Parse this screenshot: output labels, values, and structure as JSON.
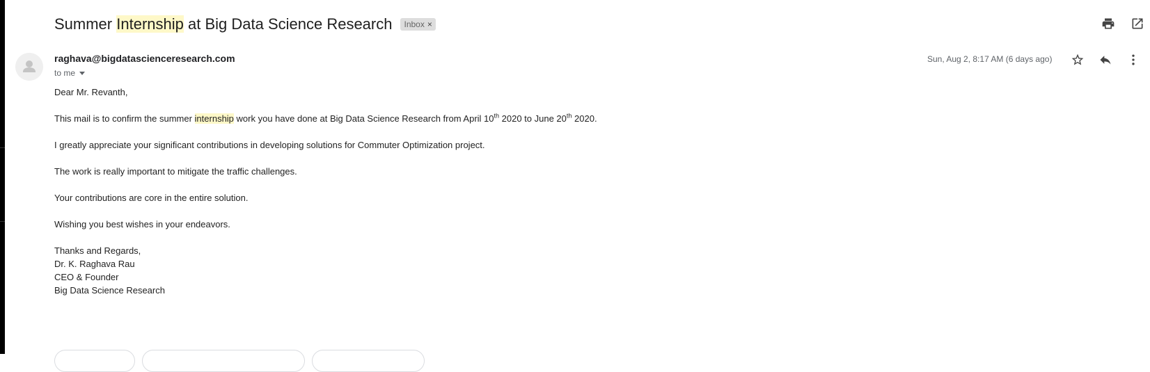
{
  "subject": {
    "before": "Summer ",
    "highlight": "Internship",
    "after": " at Big Data Science Research",
    "label": "Inbox",
    "label_remove": "×"
  },
  "message": {
    "sender_email": "raghava@bigdatascienceresearch.com",
    "recipient": "to me",
    "date": "Sun, Aug 2, 8:17 AM (6 days ago)"
  },
  "body": {
    "greeting": "Dear Mr. Revanth,",
    "p1_a": "This mail is to confirm the summer ",
    "p1_highlight": "internship",
    "p1_b": " work you have done at Big Data Science Research from April 10",
    "p1_sup1": "th",
    "p1_c": " 2020 to June 20",
    "p1_sup2": "th",
    "p1_d": " 2020.",
    "p2": "I greatly appreciate your significant contributions in developing solutions for Commuter Optimization project.",
    "p3": "The work is really important to mitigate the traffic challenges.",
    "p4": "Your contributions are core in the entire solution.",
    "p5": "Wishing you best wishes in your endeavors.",
    "sign_1": "Thanks and Regards,",
    "sign_2": "Dr. K. Raghava Rau",
    "sign_3": "CEO & Founder",
    "sign_4": "Big Data Science Research"
  },
  "icons": {
    "print": "print-icon",
    "open_new_window": "open-in-new-window-icon",
    "star": "star-icon",
    "reply": "reply-icon",
    "more": "more-vertical-icon",
    "avatar": "default-avatar-icon"
  }
}
